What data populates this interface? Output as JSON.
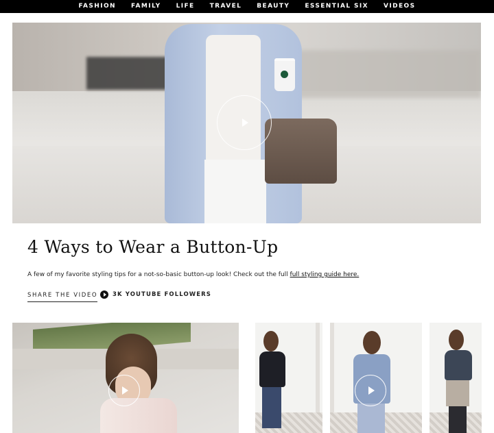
{
  "nav": {
    "items": [
      "FASHION",
      "FAMILY",
      "LIFE",
      "TRAVEL",
      "BEAUTY",
      "ESSENTIAL SIX",
      "VIDEOS"
    ]
  },
  "hero": {
    "play_icon": "play-icon"
  },
  "post": {
    "title": "4 Ways to Wear a Button-Up",
    "description_prefix": "A few of my favorite styling tips for a not-so-basic button-up look! Check out the full ",
    "description_link": "full styling guide here.",
    "share_label": "SHARE THE VIDEO",
    "youtube_label": "3K YOUTUBE FOLLOWERS",
    "youtube_icon": "youtube-play-icon"
  },
  "colors": {
    "nav_bg": "#000000",
    "nav_text": "#ffffff",
    "text": "#111111"
  }
}
